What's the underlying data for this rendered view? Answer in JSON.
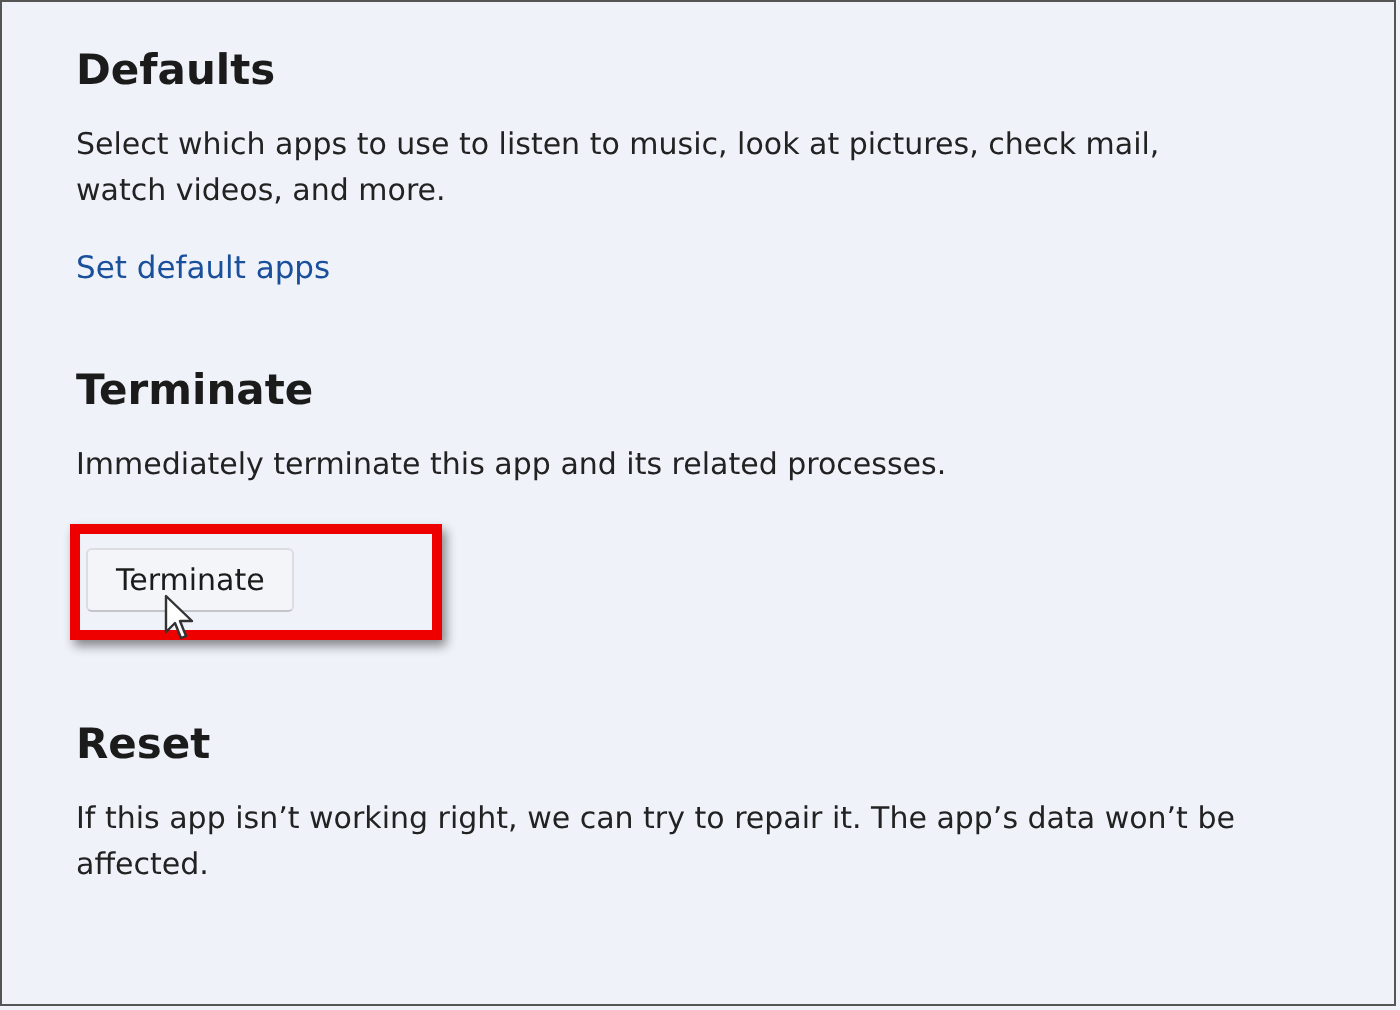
{
  "sections": [
    {
      "heading": "Defaults",
      "description": "Select which apps to use to listen to music, look at pictures, check mail, watch videos, and more.",
      "link": "Set default apps"
    },
    {
      "heading": "Terminate",
      "description": "Immediately terminate this app and its related processes.",
      "button": {
        "label": "Terminate",
        "highlighted": true
      }
    },
    {
      "heading": "Reset",
      "description": "If this app isn’t working right, we can try to repair it. The app’s data won’t be affected."
    }
  ]
}
